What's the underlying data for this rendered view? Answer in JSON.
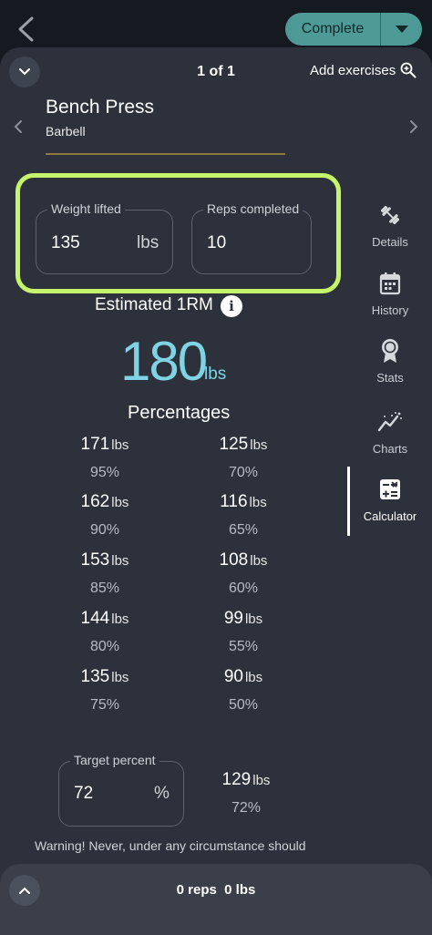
{
  "topbar": {
    "complete_label": "Complete"
  },
  "header": {
    "counter": "1 of 1",
    "add_exercises": "Add exercises"
  },
  "exercise": {
    "name": "Bench Press",
    "equipment": "Barbell"
  },
  "inputs": {
    "weight": {
      "label": "Weight lifted",
      "value": "135",
      "unit": "lbs"
    },
    "reps": {
      "label": "Reps completed",
      "value": "10"
    }
  },
  "estimate": {
    "label": "Estimated 1RM",
    "value": "180",
    "unit": "lbs"
  },
  "percentages": {
    "title": "Percentages",
    "left": [
      {
        "weight": "171",
        "unit": "lbs",
        "percent": "95%"
      },
      {
        "weight": "162",
        "unit": "lbs",
        "percent": "90%"
      },
      {
        "weight": "153",
        "unit": "lbs",
        "percent": "85%"
      },
      {
        "weight": "144",
        "unit": "lbs",
        "percent": "80%"
      },
      {
        "weight": "135",
        "unit": "lbs",
        "percent": "75%"
      }
    ],
    "right": [
      {
        "weight": "125",
        "unit": "lbs",
        "percent": "70%"
      },
      {
        "weight": "116",
        "unit": "lbs",
        "percent": "65%"
      },
      {
        "weight": "108",
        "unit": "lbs",
        "percent": "60%"
      },
      {
        "weight": "99",
        "unit": "lbs",
        "percent": "55%"
      },
      {
        "weight": "90",
        "unit": "lbs",
        "percent": "50%"
      }
    ]
  },
  "target": {
    "label": "Target percent",
    "value": "72",
    "symbol": "%",
    "result_weight": "129",
    "result_unit": "lbs",
    "result_percent": "72%"
  },
  "warning": "Warning! Never, under any circumstance should",
  "sidebar": {
    "items": [
      {
        "label": "Details",
        "icon": "dumbbell-icon"
      },
      {
        "label": "History",
        "icon": "calendar-icon"
      },
      {
        "label": "Stats",
        "icon": "medal-icon"
      },
      {
        "label": "Charts",
        "icon": "chart-line-icon"
      },
      {
        "label": "Calculator",
        "icon": "calculator-icon",
        "active": true
      }
    ]
  },
  "bottom": {
    "reps": "0 reps",
    "weight": "0 lbs"
  },
  "colors": {
    "accent": "#7fd3e4",
    "highlight": "#c6f56b",
    "complete": "#4e9a96",
    "panel": "#2c313b"
  }
}
